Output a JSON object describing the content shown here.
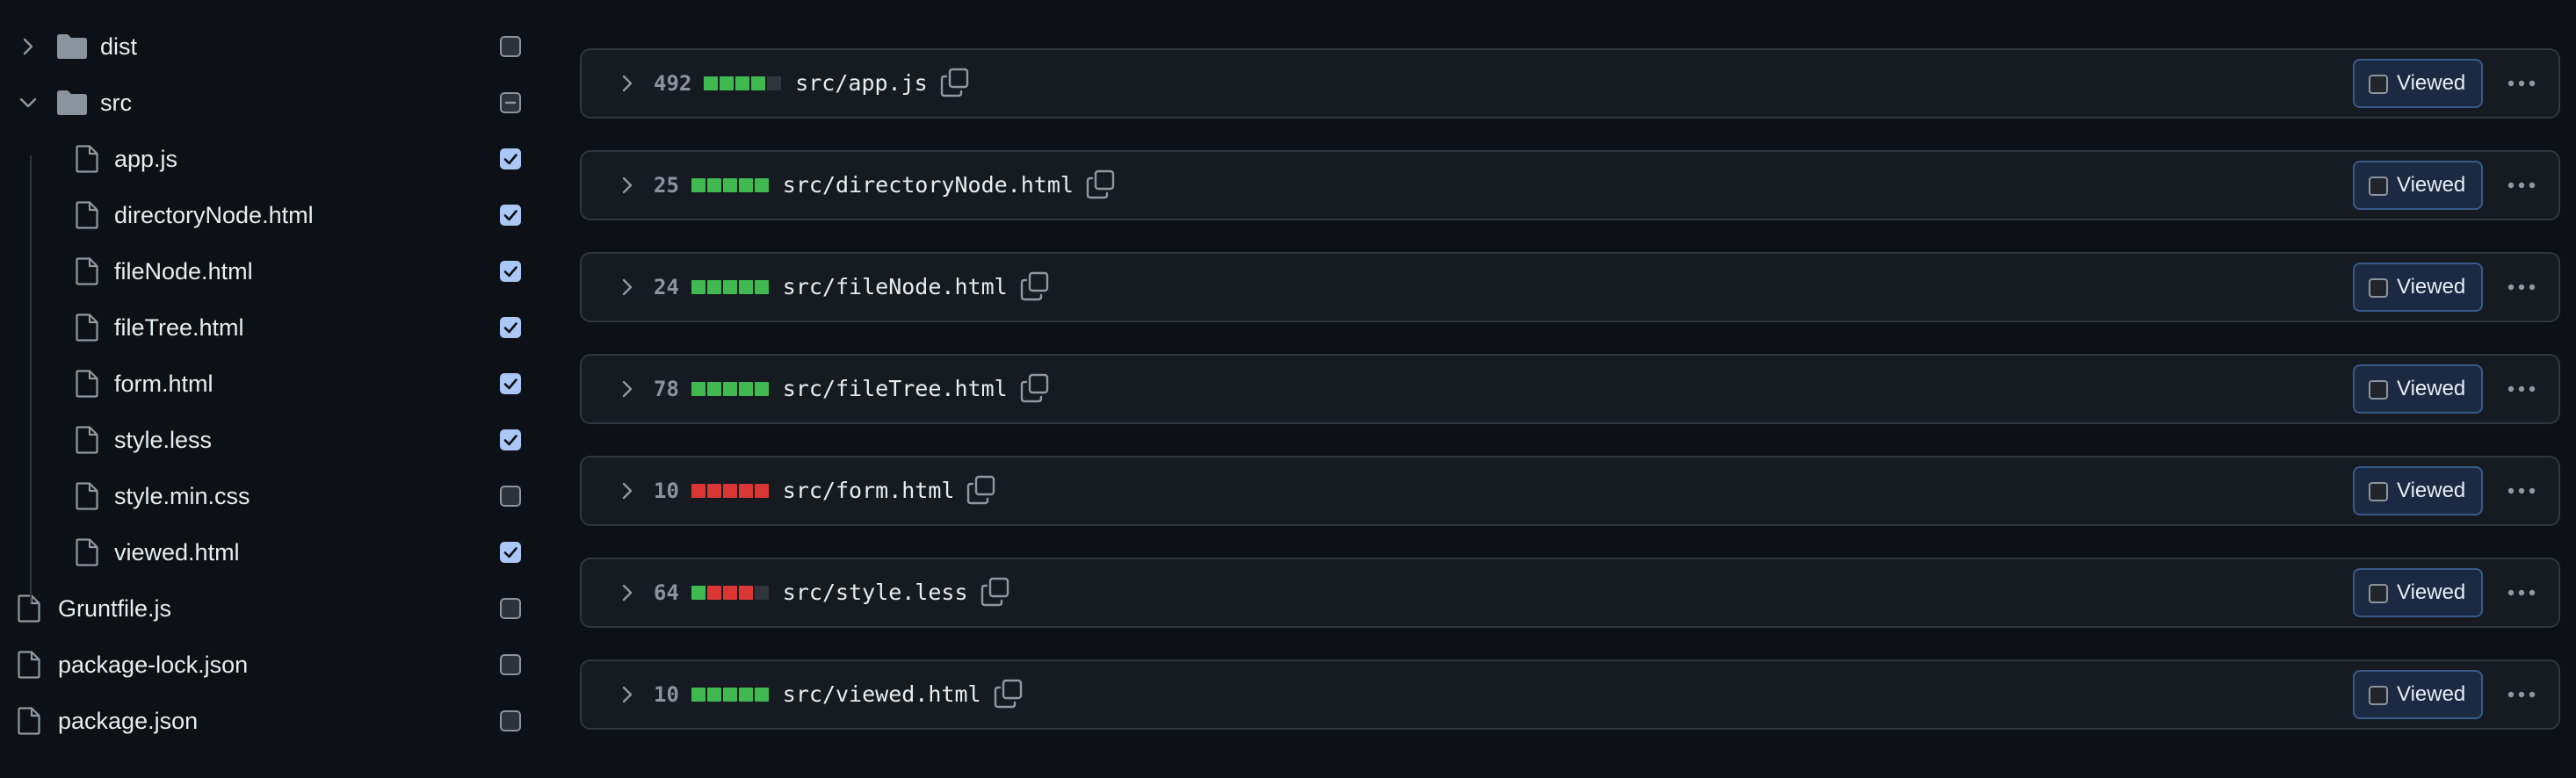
{
  "file_tree": {
    "items": [
      {
        "type": "folder",
        "name": "dist",
        "expanded": false,
        "indent": 0,
        "checkbox": "unchecked"
      },
      {
        "type": "folder",
        "name": "src",
        "expanded": true,
        "indent": 0,
        "checkbox": "mixed"
      },
      {
        "type": "file",
        "name": "app.js",
        "indent": 1,
        "checkbox": "checked"
      },
      {
        "type": "file",
        "name": "directoryNode.html",
        "indent": 1,
        "checkbox": "checked"
      },
      {
        "type": "file",
        "name": "fileNode.html",
        "indent": 1,
        "checkbox": "checked"
      },
      {
        "type": "file",
        "name": "fileTree.html",
        "indent": 1,
        "checkbox": "checked"
      },
      {
        "type": "file",
        "name": "form.html",
        "indent": 1,
        "checkbox": "checked"
      },
      {
        "type": "file",
        "name": "style.less",
        "indent": 1,
        "checkbox": "checked"
      },
      {
        "type": "file",
        "name": "style.min.css",
        "indent": 1,
        "checkbox": "unchecked"
      },
      {
        "type": "file",
        "name": "viewed.html",
        "indent": 1,
        "checkbox": "checked"
      },
      {
        "type": "file",
        "name": "Gruntfile.js",
        "indent": 0,
        "checkbox": "unchecked"
      },
      {
        "type": "file",
        "name": "package-lock.json",
        "indent": 0,
        "checkbox": "unchecked"
      },
      {
        "type": "file",
        "name": "package.json",
        "indent": 0,
        "checkbox": "unchecked"
      }
    ]
  },
  "diffs": {
    "viewed_label": "Viewed",
    "files": [
      {
        "count": "492",
        "path": "src/app.js",
        "bars": [
          "add",
          "add",
          "add",
          "add",
          "neutral"
        ]
      },
      {
        "count": "25",
        "path": "src/directoryNode.html",
        "bars": [
          "add",
          "add",
          "add",
          "add",
          "add"
        ]
      },
      {
        "count": "24",
        "path": "src/fileNode.html",
        "bars": [
          "add",
          "add",
          "add",
          "add",
          "add"
        ]
      },
      {
        "count": "78",
        "path": "src/fileTree.html",
        "bars": [
          "add",
          "add",
          "add",
          "add",
          "add"
        ]
      },
      {
        "count": "10",
        "path": "src/form.html",
        "bars": [
          "del",
          "del",
          "del",
          "del",
          "del"
        ]
      },
      {
        "count": "64",
        "path": "src/style.less",
        "bars": [
          "add",
          "del",
          "del",
          "del",
          "neutral"
        ]
      },
      {
        "count": "10",
        "path": "src/viewed.html",
        "bars": [
          "add",
          "add",
          "add",
          "add",
          "add"
        ]
      }
    ]
  },
  "colors": {
    "add": "#3fb950",
    "del": "#da3633",
    "neutral": "#30363d",
    "background": "#0d1117",
    "panel": "#161b22",
    "border": "#30363d",
    "checkbox_checked": "#a9c8f5"
  },
  "icons": {
    "collapsed": "chevron-right-icon",
    "expanded": "chevron-down-icon",
    "folder": "folder-icon",
    "file": "file-icon",
    "copy": "copy-icon",
    "more": "kebab-horizontal-icon"
  }
}
